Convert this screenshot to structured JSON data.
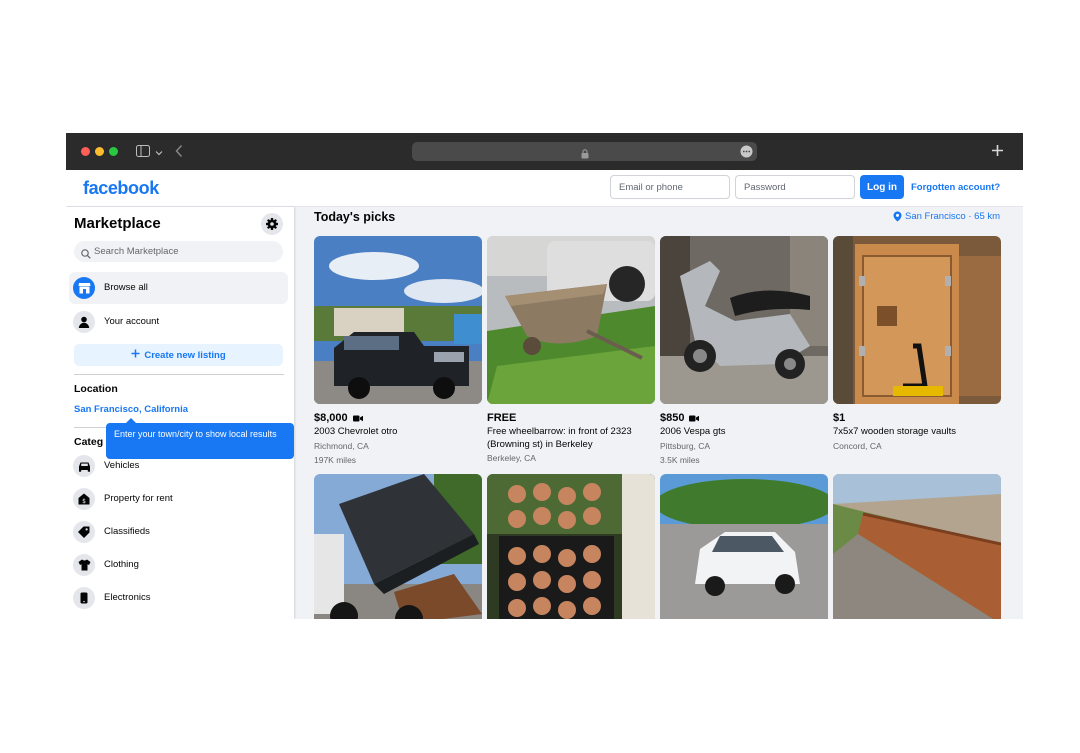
{
  "header": {
    "logo": "facebook",
    "email_placeholder": "Email or phone",
    "password_placeholder": "Password",
    "login_label": "Log in",
    "forgot_label": "Forgotten account?"
  },
  "sidebar": {
    "title": "Marketplace",
    "search_placeholder": "Search Marketplace",
    "nav": [
      {
        "label": "Browse all",
        "icon": "store-icon"
      },
      {
        "label": "Your account",
        "icon": "person-icon"
      }
    ],
    "create_label": "Create new listing",
    "location_heading": "Location",
    "location_value": "San Francisco, California",
    "categories_heading": "Categ",
    "tooltip": "Enter your town/city to show local results",
    "categories": [
      {
        "label": "Vehicles",
        "icon": "car-icon"
      },
      {
        "label": "Property for rent",
        "icon": "house-icon"
      },
      {
        "label": "Classifieds",
        "icon": "tag-icon"
      },
      {
        "label": "Clothing",
        "icon": "shirt-icon"
      },
      {
        "label": "Electronics",
        "icon": "phone-icon"
      }
    ]
  },
  "main": {
    "title": "Today's picks",
    "location_link": "San Francisco · 65 km",
    "listings": [
      {
        "price": "$8,000",
        "title": "2003 Chevrolet otro",
        "location": "Richmond, CA",
        "extra": "197K miles",
        "video": true,
        "image": "pickup-truck"
      },
      {
        "price": "FREE",
        "title": "Free wheelbarrow: in front of 2323 (Browning st) in Berkeley",
        "location": "Berkeley, CA",
        "extra": "",
        "video": false,
        "image": "wheelbarrow"
      },
      {
        "price": "$850",
        "title": "2006 Vespa gts",
        "location": "Pittsburg, CA",
        "extra": "3.5K miles",
        "video": true,
        "image": "scooter"
      },
      {
        "price": "$1",
        "title": "7x5x7 wooden storage vaults",
        "location": "Concord, CA",
        "extra": "",
        "video": false,
        "image": "wooden-vault"
      },
      {
        "price": "",
        "title": "",
        "location": "",
        "extra": "",
        "video": false,
        "image": "dump-truck"
      },
      {
        "price": "",
        "title": "",
        "location": "",
        "extra": "",
        "video": false,
        "image": "plants"
      },
      {
        "price": "",
        "title": "",
        "location": "",
        "extra": "",
        "video": false,
        "image": "white-sedan"
      },
      {
        "price": "",
        "title": "",
        "location": "",
        "extra": "",
        "video": false,
        "image": "retaining-wall"
      }
    ]
  },
  "colors": {
    "brand": "#1877f2",
    "background": "#f0f2f5",
    "browser_chrome": "#2b2b2b"
  }
}
